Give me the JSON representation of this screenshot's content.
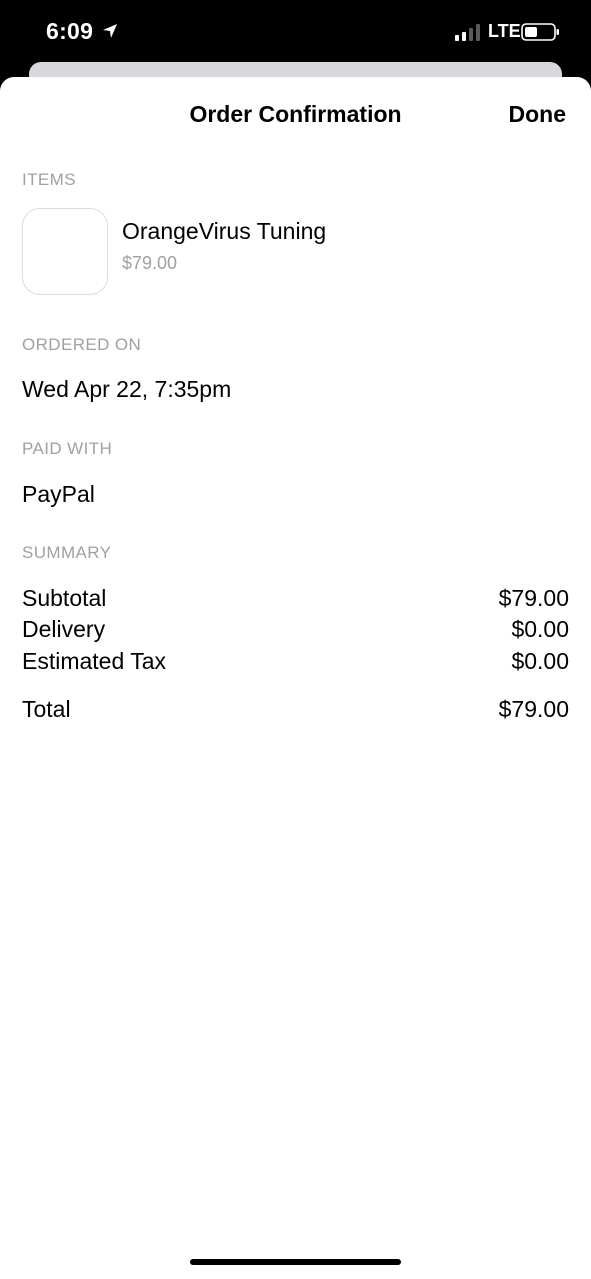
{
  "status_bar": {
    "time": "6:09",
    "network": "LTE",
    "icons": [
      "location-arrow-icon",
      "signal-icon",
      "battery-icon"
    ]
  },
  "nav": {
    "title": "Order Confirmation",
    "done_label": "Done"
  },
  "items_section": {
    "label": "ITEMS",
    "items": [
      {
        "name": "OrangeVirus Tuning",
        "price": "$79.00"
      }
    ]
  },
  "ordered_on": {
    "label": "ORDERED ON",
    "value": "Wed Apr 22, 7:35pm"
  },
  "paid_with": {
    "label": "PAID WITH",
    "value": "PayPal"
  },
  "summary": {
    "label": "SUMMARY",
    "rows": [
      {
        "label": "Subtotal",
        "amount": "$79.00"
      },
      {
        "label": "Delivery",
        "amount": "$0.00"
      },
      {
        "label": "Estimated Tax",
        "amount": "$0.00"
      }
    ],
    "total": {
      "label": "Total",
      "amount": "$79.00"
    }
  },
  "colors": {
    "text": "#000000",
    "secondary_text": "#a0a0a5",
    "background": "#ffffff",
    "status_bar_bg": "#000000"
  }
}
